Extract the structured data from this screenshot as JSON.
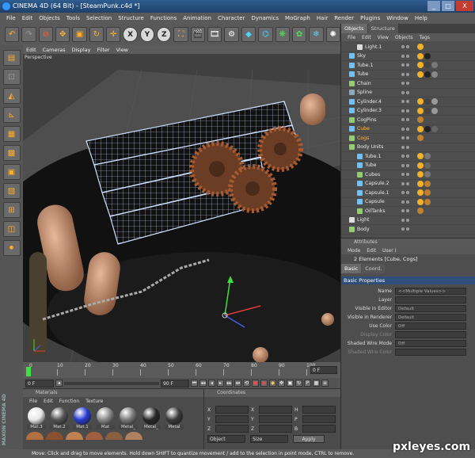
{
  "window": {
    "title": "CINEMA 4D (64 Bit) - [SteamPunk.c4d *]",
    "min": "_",
    "max": "□",
    "close": "X"
  },
  "menu": [
    "File",
    "Edit",
    "Objects",
    "Tools",
    "Selection",
    "Structure",
    "Functions",
    "Animation",
    "Character",
    "Dynamics",
    "MoGraph",
    "Hair",
    "Render",
    "Plugins",
    "Window",
    "Help"
  ],
  "toolbar": {
    "icons": [
      "undo-icon",
      "redo-icon",
      "live-selection-icon",
      "move-icon",
      "scale-icon",
      "rotate-icon",
      "move-icon"
    ],
    "axes": [
      "X",
      "Y",
      "Z"
    ]
  },
  "viewport": {
    "menu": [
      "Edit",
      "Cameras",
      "Display",
      "Filter",
      "View"
    ],
    "label": "Perspective"
  },
  "timeline": {
    "ticks": [
      "0",
      "10",
      "20",
      "30",
      "40",
      "50",
      "60",
      "70",
      "80",
      "90",
      "100"
    ],
    "frame_field": "0 F",
    "start_field": "0 F",
    "end_field": "90 F",
    "current_field": "0 F"
  },
  "materials": {
    "title": "Materials",
    "menu": [
      "File",
      "Edit",
      "Function",
      "Texture"
    ],
    "items": [
      {
        "name": "Mat.3",
        "color": "#e8e8e8"
      },
      {
        "name": "Mat.2",
        "color": "#555555"
      },
      {
        "name": "Mat.1",
        "color": "#2a3bd0"
      },
      {
        "name": "Mat",
        "color": "#8a8a8a"
      },
      {
        "name": "Metal_",
        "color": "#7a7a7a"
      },
      {
        "name": "Metal_",
        "color": "#2a2a2a"
      },
      {
        "name": "Metal",
        "color": "#3a3a3a"
      }
    ]
  },
  "coordinates": {
    "title": "Coordinates",
    "rows": [
      {
        "a": "X",
        "b": "X",
        "c": "H"
      },
      {
        "a": "Y",
        "b": "Y",
        "c": "P"
      },
      {
        "a": "Z",
        "b": "Z",
        "c": "B"
      }
    ],
    "mode": "Object",
    "size_mode": "Size",
    "apply": "Apply"
  },
  "objects_panel": {
    "tabs": [
      "Objects",
      "Structure"
    ],
    "menu": [
      "File",
      "Edit",
      "View",
      "Objects",
      "Tags"
    ],
    "rows": [
      {
        "name": "Light.1",
        "indent": 1,
        "color": "#ddd",
        "tags": [
          "#f2b12a"
        ]
      },
      {
        "name": "Sky",
        "indent": 0,
        "color": "#6ac2ff",
        "tags": [
          "#f2b12a",
          "#222"
        ]
      },
      {
        "name": "Tube.1",
        "indent": 0,
        "color": "#6ac2ff",
        "tags": [
          "#f2b12a",
          "#444",
          "#777"
        ]
      },
      {
        "name": "Tube",
        "indent": 0,
        "color": "#6ac2ff",
        "tags": [
          "#f2b12a",
          "#222",
          "#888"
        ]
      },
      {
        "name": "Chain",
        "indent": 0,
        "color": "#8fd06a",
        "tags": []
      },
      {
        "name": "Spline",
        "indent": 0,
        "color": "#8ab",
        "tags": []
      },
      {
        "name": "Cylinder.4",
        "indent": 0,
        "color": "#6ac2ff",
        "tags": [
          "#f2b12a",
          "#444",
          "#999"
        ]
      },
      {
        "name": "Cylinder.3",
        "indent": 0,
        "color": "#6ac2ff",
        "tags": [
          "#f2b12a",
          "#444",
          "#999"
        ]
      },
      {
        "name": "CogPins",
        "indent": 0,
        "color": "#8fd06a",
        "tags": [
          "#c08030"
        ]
      },
      {
        "name": "Cube",
        "indent": 0,
        "color": "#6ac2ff",
        "tags": [
          "#f2b12a",
          "#222",
          "#666"
        ]
      },
      {
        "name": "Cogs",
        "indent": 0,
        "color": "#8fd06a",
        "tags": [
          "#c08030"
        ]
      },
      {
        "name": "Body Units",
        "indent": 0,
        "color": "#8fd06a",
        "tags": []
      },
      {
        "name": "Tube.1",
        "indent": 1,
        "color": "#6ac2ff",
        "tags": [
          "#f2b12a",
          "#777"
        ]
      },
      {
        "name": "Tube",
        "indent": 1,
        "color": "#6ac2ff",
        "tags": [
          "#f2b12a",
          "#666"
        ]
      },
      {
        "name": "Cubes",
        "indent": 1,
        "color": "#8fd06a",
        "tags": [
          "#f2b12a",
          "#777"
        ]
      },
      {
        "name": "Capsule.2",
        "indent": 1,
        "color": "#6ac2ff",
        "tags": [
          "#f2b12a",
          "#c08030"
        ]
      },
      {
        "name": "Capsule.1",
        "indent": 1,
        "color": "#6ac2ff",
        "tags": [
          "#f2b12a",
          "#c08030"
        ]
      },
      {
        "name": "Capsule",
        "indent": 1,
        "color": "#6ac2ff",
        "tags": [
          "#f2b12a",
          "#c08030"
        ]
      },
      {
        "name": "OilTanks",
        "indent": 1,
        "color": "#8fd06a",
        "tags": [
          "#c08030"
        ]
      },
      {
        "name": "Light",
        "indent": 0,
        "color": "#ddd",
        "tags": []
      },
      {
        "name": "Body",
        "indent": 0,
        "color": "#8fd06a",
        "tags": []
      }
    ]
  },
  "attributes_panel": {
    "title": "Attributes",
    "menu": [
      "Mode",
      "Edit",
      "User I"
    ],
    "selection": "2 Elements [Cube, Cogs]",
    "tabs": [
      "Basic",
      "Coord."
    ],
    "section": "Basic Properties",
    "rows": [
      {
        "label": "Name",
        "value": "<<Multiple Values>>",
        "dim": false
      },
      {
        "label": "Layer",
        "value": "",
        "dim": false
      },
      {
        "label": "Visible in Editor",
        "value": "Default",
        "dim": false
      },
      {
        "label": "Visible in Renderer",
        "value": "Default",
        "dim": false
      },
      {
        "label": "Use Color",
        "value": "Off",
        "dim": false
      },
      {
        "label": "Display Color",
        "value": "",
        "dim": true
      },
      {
        "label": "Shaded Wire Mode",
        "value": "Off",
        "dim": false
      },
      {
        "label": "Shaded Wire Color",
        "value": "",
        "dim": true
      }
    ]
  },
  "status": "Move: Click and drag to move elements. Hold down SHIFT to quantize movement / add to the selection in point mode, CTRL to remove.",
  "logo": "MAXON CINEMA 4D",
  "watermark": "pxleyes.com"
}
